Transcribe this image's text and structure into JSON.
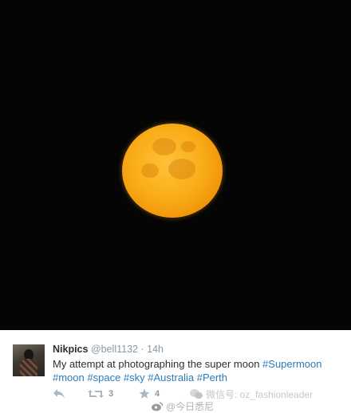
{
  "tweet": {
    "display_name": "Nikpics",
    "handle": "@bell1132",
    "separator": "·",
    "time": "14h",
    "text_before": "My attempt at photographing the super moon ",
    "hashtags": [
      "#Supermoon",
      "#moon",
      "#space",
      "#sky",
      "#Australia",
      "#Perth"
    ],
    "actions": {
      "reply_icon": "reply-icon",
      "retweet_icon": "retweet-icon",
      "retweet_count": "3",
      "favorite_icon": "star-icon",
      "favorite_count": "4"
    }
  },
  "watermark": {
    "wechat_id": "微信号: oz_fashionleader",
    "account_name": "@今日悉尼"
  },
  "colors": {
    "photo_background": "#050505",
    "moon": "#f9ad18",
    "hashtag": "#2b7bb9",
    "muted": "#8899a6"
  }
}
